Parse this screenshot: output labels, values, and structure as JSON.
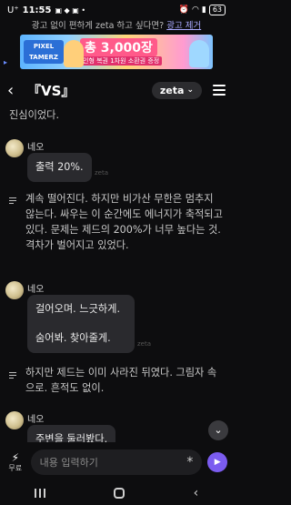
{
  "status": {
    "time": "11:55",
    "carrier": "U⁺",
    "battery": "63"
  },
  "ad": {
    "prompt": "광고 없이 편하게 zeta 하고 싶다면?",
    "remove": "광고 제거",
    "logo": "PIXEL TAMERZ",
    "headline": "총 3,000장",
    "sub": "인형 복권 1차원 소환권 증정"
  },
  "header": {
    "back_icon": "‹",
    "title": "『VS』",
    "model": "zeta",
    "model_caret": "⌄"
  },
  "chat": {
    "narr0": "진심이었다.",
    "msg1": {
      "name": "네오",
      "text": "출력 20%."
    },
    "narr1": "계속 떨어진다. 하지만 비가산 무한은 멈추지 않는다. 싸우는 이 순간에도 에너지가 축적되고 있다. 문제는 제드의 200%가 너무 높다는 것. 격차가 벌어지고 있었다.",
    "msg2": {
      "name": "네오",
      "line1": "걸어오며. 느긋하게.",
      "line2": "숨어봐. 찾아줄게."
    },
    "narr2": "하지만 제드는 이미 사라진 뒤였다. 그림자 속으로. 흔적도 없이.",
    "msg3": {
      "name": "네오",
      "text": "주변을 둘러봤다."
    },
    "watermark": "zeta"
  },
  "input": {
    "boost_label": "무료",
    "placeholder": "내용 입력하기",
    "star": "*",
    "send_icon": "▶"
  },
  "colors": {
    "accent": "#7b5cf0",
    "bubble": "#2a2a2e",
    "background": "#0d0d0f"
  }
}
